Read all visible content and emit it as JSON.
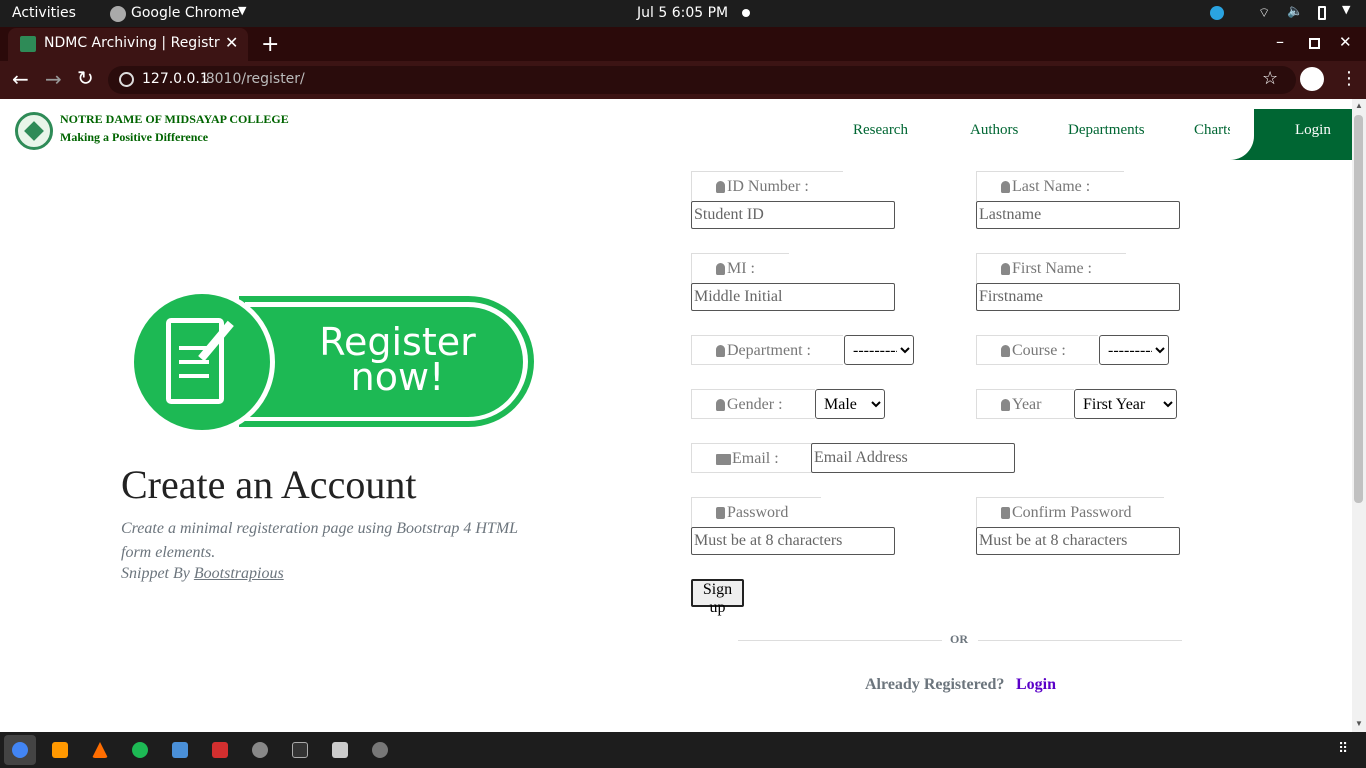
{
  "system": {
    "activities": "Activities",
    "app": "Google Chrome",
    "datetime": "Jul 5   6:05 PM"
  },
  "browser": {
    "tab_title": "NDMC Archiving | Registr",
    "url_host": "127.0.0.1",
    "url_rest": ":8010/register/"
  },
  "header": {
    "college": "NOTRE DAME OF MIDSAYAP COLLEGE",
    "tagline": "Making a Positive Difference",
    "nav": {
      "research": "Research",
      "authors": "Authors",
      "departments": "Departments",
      "charts": "Charts",
      "login": "Login"
    }
  },
  "hero": {
    "banner_line1": "Register",
    "banner_line2": "now!",
    "title": "Create an Account",
    "desc": "Create a minimal registeration page using Bootstrap 4 HTML form elements.",
    "snippet_prefix": "Snippet By",
    "snippet_link": "Bootstrapious"
  },
  "form": {
    "id_label": "ID Number :",
    "id_placeholder": "Student ID",
    "last_label": "Last Name :",
    "last_placeholder": "Lastname",
    "mi_label": "MI :",
    "mi_placeholder": "Middle Initial",
    "first_label": "First Name :",
    "first_placeholder": "Firstname",
    "dept_label": "Department :",
    "dept_value": "---------",
    "course_label": "Course :",
    "course_value": "---------",
    "gender_label": "Gender :",
    "gender_value": "Male",
    "year_label": "Year",
    "year_value": "First Year",
    "email_label": "Email :",
    "email_placeholder": "Email Address",
    "pw_label": "Password",
    "pw_placeholder": "Must be at 8 characters",
    "cpw_label": "Confirm Password",
    "cpw_placeholder": "Must be at 8 characters",
    "signup": "Sign up",
    "or": "OR",
    "already": "Already Registered?",
    "login": "Login"
  },
  "colors": {
    "brand_green": "#006633",
    "banner_green": "#1db954",
    "link_purple": "#5a00c8"
  }
}
